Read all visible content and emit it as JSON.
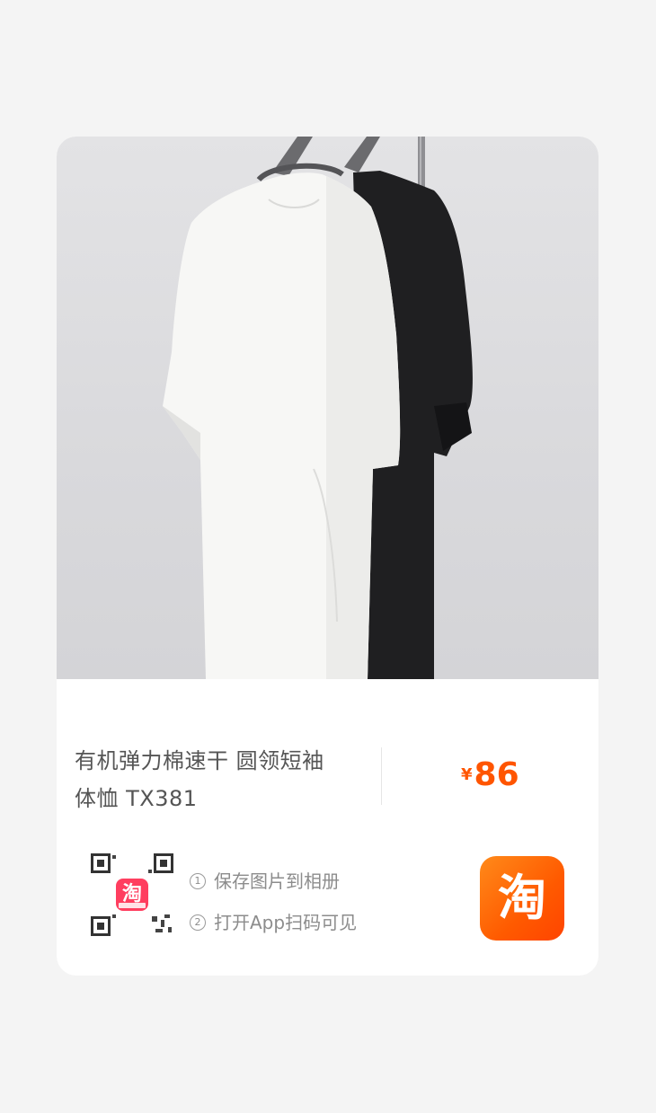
{
  "product": {
    "title_line1": "有机弹力棉速干 圆领短袖",
    "title_line2": "体恤 TX381",
    "currency_symbol": "¥",
    "price": "86"
  },
  "instructions": {
    "step1_num": "1",
    "step1_text": "保存图片到相册",
    "step2_num": "2",
    "step2_text": "打开App扫码可见"
  },
  "qr_badge_text": "淘",
  "app_logo_text": "淘",
  "colors": {
    "accent": "#ff5500",
    "logo_start": "#ff8a1a",
    "logo_end": "#ff4400"
  },
  "icons": [
    "qr-code-icon",
    "taobao-app-icon"
  ]
}
